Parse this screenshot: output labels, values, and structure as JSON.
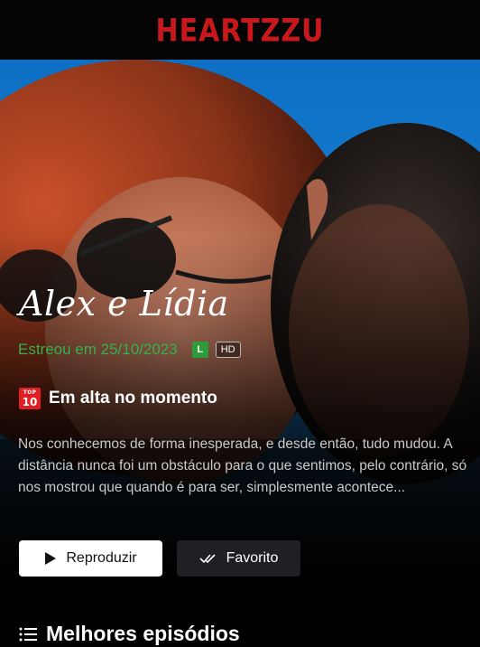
{
  "header": {
    "logo_text": "HEARTZZU",
    "logo_color": "#c8181c"
  },
  "hero": {
    "title": "Alex e Lídia",
    "premiere": "Estreou em 25/10/2023",
    "rating": "L",
    "quality": "HD",
    "trend_badge_top": "TOP",
    "trend_badge_num": "10",
    "trend_text": "Em alta no momento",
    "description": "Nos conhecemos de forma inesperada, e desde então, tudo mudou. A distância nunca foi um obstáculo para o que sentimos, pelo contrário, só nos mostrou que quando é para ser, simplesmente acontece...",
    "play_label": "Reproduzir",
    "favorite_label": "Favorito"
  },
  "section": {
    "title": "Melhores episódios"
  },
  "colors": {
    "premiere": "#35b04a",
    "rating_bg": "#2d9b3a",
    "top10_bg": "#e01e24"
  },
  "icons": [
    "top10-icon",
    "play-icon",
    "double-check-icon",
    "list-icon"
  ]
}
